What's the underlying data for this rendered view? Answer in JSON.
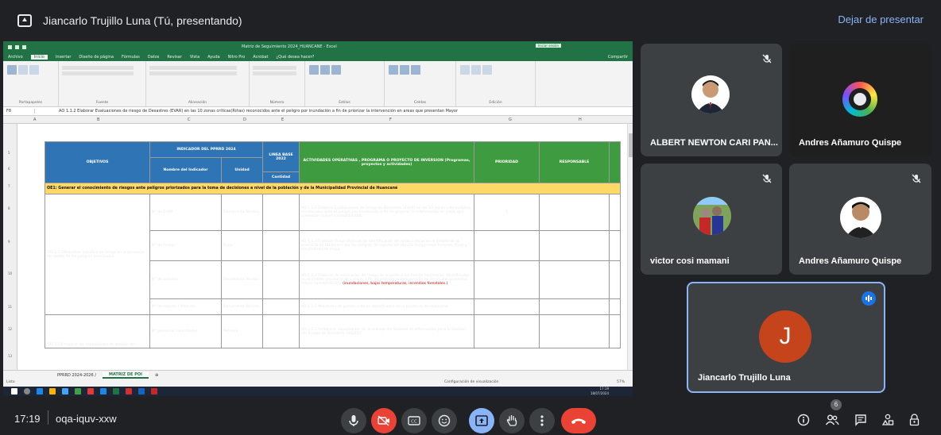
{
  "topbar": {
    "presenter": "Jiancarlo Trujillo Luna (Tú, presentando)",
    "stop_label": "Dejar de presentar"
  },
  "excel": {
    "doc_title": "Matriz de Seguimiento 2024_HUANCANE - Excel",
    "login": "Iniciar sesión",
    "tabs": [
      "Archivo",
      "Inicio",
      "Insertar",
      "Diseño de página",
      "Fórmulas",
      "Datos",
      "Revisar",
      "Vista",
      "Ayuda",
      "Nitro Pro",
      "Acrobat",
      "¿Qué desea hacer?"
    ],
    "share": "Compartir",
    "ribbon_groups": [
      "Portapapeles",
      "Fuente",
      "Alineación",
      "Número",
      "Estilos",
      "Celdas",
      "Edición"
    ],
    "cell_ref": "F8",
    "formula": "AO 1.1.2 Elaborar Evaluaciones de riesgo de Desastres (EVAR) en las 10 zonas críticas(Riñas) reconocidos ante el peligro por inundación a fin de priorizar la intervención en areas que presentan Mayor",
    "columns": [
      "A",
      "B",
      "C",
      "D",
      "E",
      "F",
      "G",
      "H"
    ],
    "row_numbers": [
      "5",
      "6",
      "7",
      "8",
      "9",
      "10",
      "11",
      "12",
      "13"
    ],
    "header": {
      "objetivos": "OBJETIVOS",
      "indicador": "INDICADOR DEL PPRRD 2024",
      "nombre_indicador": "Nombre del Indicador",
      "unidad": "Unidad",
      "linea_base": "LINEA BASE 2022",
      "cantidad": "Cantidad",
      "actividades": "ACTIVIDADES OPERATIVAS , PROGRAMA O PROYECTO DE INVERSION (Programas, proyectos y actividades)",
      "prioridad": "PRIORIDAD",
      "responsable": "RESPONSABLE"
    },
    "oe_row": "OE1: Generar el conocimiento de riesgos ante peligros priorizados para la toma de decisiones a nivel de la población y de la Municipalidad Provincial de Huancané",
    "oei": "OEI 1.1 Desarrollar estudios de riesgo en la provincia de sandia de los peligros priorizados.",
    "oei2": "OEI 1.14 mejorar las capacidades en gestión de",
    "rows": [
      {
        "indicator": "N° de EVAR",
        "unit": "Documento Técnico",
        "activity": "AO 1.1.2 Elaborar Evaluaciones de riesgo de Desastres (EVAR) en las 10 zonas críticas(Riñas) reconocidos ante el peligro por inundación a fin de priorizar la intervención en areas que presentan mayor susceptibilidad.",
        "priority": "1"
      },
      {
        "indicator": "N° de Fichas",
        "unit": "Ficha",
        "activity": "AO 1.1.3 Elaborar fichas técnicas de identificación de zonas críticas en el ámbito de la provincia de Huancané por los peligros de inundación (lluvias temporales) heladas, friaje y movimiento de masa.",
        "priority": ""
      },
      {
        "indicator": "N° de estudios",
        "unit": "Documento Técnico",
        "activity": "AO 1.1.4 Elaborar de escenarios de riesgo de acuerdo a los demás fenómenos identificados en el ámbito provincial de Lampa, a fin de priorizar la intervención en áreas que presentan mayor susceptibilidad",
        "activity_red": "(inundaciones, bajas temperaturas, incendios forestales.)",
        "priority": ""
      },
      {
        "indicator": "N° de reporte / ficha tst",
        "unit": "Documento Técnico",
        "activity": "AO 1.1.5 Monitoreo de puntos críticos identificados en la provincia de Huancané",
        "priority": ""
      },
      {
        "indicator": "N° personas capacitadas",
        "unit": "Persona",
        "activity": "AO 2.1.1 Fortalecer capacidades en el manejo del Sistema de Información para la Gestión del Riesgo de Desastres (SIGRD)",
        "priority": ""
      }
    ],
    "sheets": [
      "PPRRD 2024-2026 /",
      "MATRIZ DE POI"
    ],
    "status_left": "Listo",
    "status_right": "Configuración de visualización",
    "zoom": "57%",
    "clock_time": "17:19",
    "clock_date": "18/07/2024"
  },
  "participants": [
    {
      "name": "ALBERT NEWTON CARI PAN...",
      "muted": true
    },
    {
      "name": "Andres Añamuro Quispe",
      "muted": false
    },
    {
      "name": "victor cosi mamani",
      "muted": true
    },
    {
      "name": "Andres Añamuro Quispe",
      "muted": true
    },
    {
      "name": "Jiancarlo Trujillo Luna",
      "initial": "J",
      "avatar_color": "#c5441b"
    }
  ],
  "bottombar": {
    "time": "17:19",
    "meeting_code": "oqa-iquv-xxw",
    "participant_count": "6"
  },
  "colors": {
    "excel_green": "#217346",
    "header_blue": "#2f75b5",
    "header_green": "#3f9b3f",
    "oe_yellow": "#ffd966",
    "hangup_red": "#ea4335",
    "speaking_blue": "#8ab4f8"
  }
}
